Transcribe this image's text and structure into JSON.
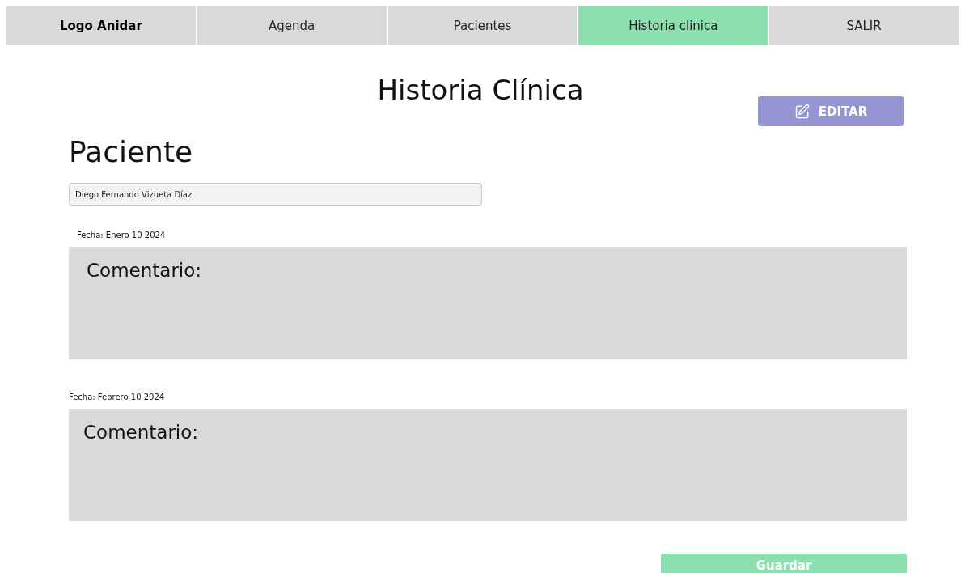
{
  "nav": {
    "logo": "Logo Anidar",
    "tabs": [
      {
        "label": "Agenda",
        "selected": false
      },
      {
        "label": "Pacientes",
        "selected": false
      },
      {
        "label": "Historia clinica",
        "selected": true
      },
      {
        "label": "SALIR",
        "selected": false
      }
    ]
  },
  "title": "Historia Clínica",
  "edit_button": "EDITAR",
  "patient": {
    "heading": "Paciente",
    "value": "Diego Fernando Vizueta Díaz"
  },
  "entries": [
    {
      "date": "Fecha:  Enero 10 2024",
      "comment": "Comentario:"
    },
    {
      "date": "Fecha:  Febrero 10 2024",
      "comment": "Comentario:"
    }
  ],
  "save_button": "Guardar"
}
